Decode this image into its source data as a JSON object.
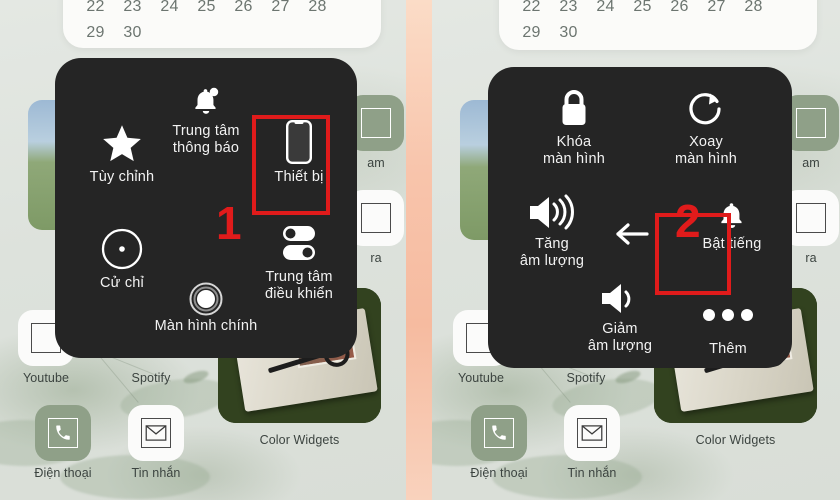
{
  "meta": {
    "title": "iOS AssistiveTouch menu tutorial",
    "accent_red": "#e01b1b",
    "panel_bg": "#252525",
    "wallpaper_bg": "#dfe3de",
    "divider_color": "#f6c4ad"
  },
  "calendar": {
    "row1": [
      "22",
      "23",
      "24",
      "25",
      "26",
      "27",
      "28"
    ],
    "row2": [
      "29",
      "30"
    ]
  },
  "home_apps": {
    "youtube": "Youtube",
    "spotify": "Spotify",
    "phone": "Điện thoại",
    "messages": "Tin nhắn",
    "color_widgets": "Color Widgets",
    "partial_instagram": "am",
    "partial_camera": "ra"
  },
  "left_panel": {
    "step_number": "1",
    "items": [
      {
        "name": "notification-center",
        "icon": "bell-icon",
        "label": "Trung tâm\nthông báo"
      },
      {
        "name": "custom",
        "icon": "star-icon",
        "label": "Tùy chỉnh"
      },
      {
        "name": "device",
        "icon": "phone-device-icon",
        "label": "Thiết bị"
      },
      {
        "name": "gestures",
        "icon": "circle-dot-icon",
        "label": "Cử chỉ"
      },
      {
        "name": "control-center",
        "icon": "toggles-icon",
        "label": "Trung tâm\nđiều khiển"
      },
      {
        "name": "home-screen",
        "icon": "home-ring-icon",
        "label": "Màn hình chính"
      }
    ],
    "highlight_target": "Thiết bị"
  },
  "right_panel": {
    "step_number": "2",
    "items": [
      {
        "name": "lock-screen",
        "icon": "lock-icon",
        "label": "Khóa\nmàn hình"
      },
      {
        "name": "rotate-screen",
        "icon": "rotate-icon",
        "label": "Xoay\nmàn hình"
      },
      {
        "name": "volume-up",
        "icon": "volume-up-icon",
        "label": "Tăng\nâm lượng"
      },
      {
        "name": "unmute",
        "icon": "bell-ring-icon",
        "label": "Bật tiếng"
      },
      {
        "name": "volume-down",
        "icon": "volume-down-icon",
        "label": "Giảm\nâm lượng"
      },
      {
        "name": "more",
        "icon": "ellipsis-icon",
        "label": "Thêm"
      }
    ],
    "back_icon": "arrow-left-icon",
    "highlight_target": "Thêm"
  }
}
